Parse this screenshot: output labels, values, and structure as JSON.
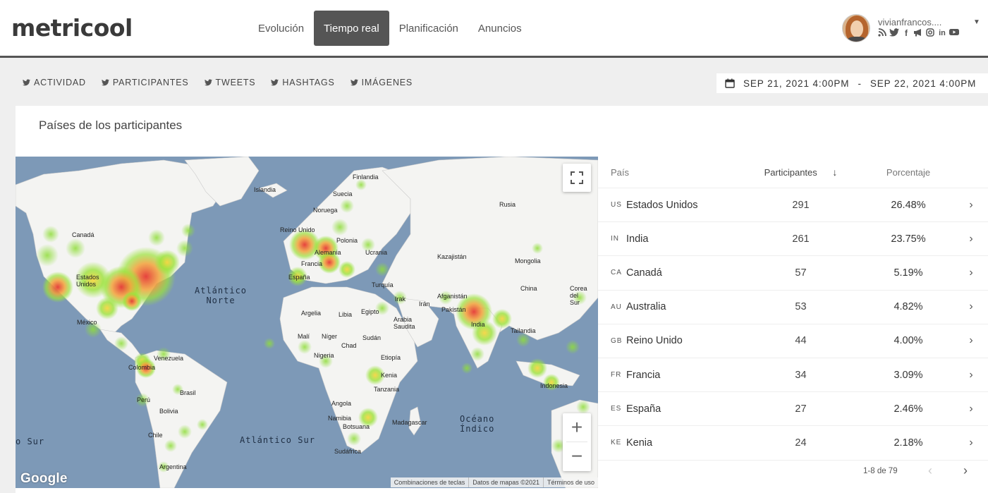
{
  "app": {
    "logo": "metricool",
    "nav": [
      "Evolución",
      "Tiempo real",
      "Planificación",
      "Anuncios"
    ],
    "active_nav": "Tiempo real",
    "user": {
      "name": "vivianfrancos....",
      "social_icons": [
        "rss-icon",
        "twitter-icon",
        "facebook-icon",
        "megaphone-icon",
        "instagram-icon",
        "linkedin-icon",
        "youtube-icon"
      ]
    }
  },
  "subtabs": [
    "ACTIVIDAD",
    "PARTICIPANTES",
    "TWEETS",
    "HASHTAGS",
    "IMÁGENES"
  ],
  "date_range": {
    "start": "SEP 21, 2021 4:00PM",
    "separator": "-",
    "end": "SEP 22, 2021 4:00PM"
  },
  "card": {
    "title": "Países de los participantes"
  },
  "map": {
    "labels": {
      "finlandia": "Finlandia",
      "islandia": "Islandia",
      "suecia": "Suecia",
      "noruega": "Noruega",
      "rusia": "Rusia",
      "reino_unido": "Reino Unido",
      "polonia": "Polonia",
      "alemania": "Alemania",
      "ucrania": "Ucrania",
      "kazajistan": "Kazajistán",
      "francia": "Francia",
      "mongolia": "Mongolia",
      "espana": "España",
      "turquia": "Turquía",
      "china": "China",
      "corea": "Corea del Sur",
      "canada": "Canadá",
      "estados_unidos": "Estados Unidos",
      "irak": "Irak",
      "iran": "Irán",
      "afganistan": "Afganistán",
      "argelia": "Argelia",
      "libia": "Libia",
      "egipto": "Egipto",
      "pakistan": "Pakistán",
      "mexico": "México",
      "arabia": "Arabia Saudita",
      "india": "India",
      "tailandia": "Tailandia",
      "mali": "Malí",
      "niger": "Níger",
      "chad": "Chad",
      "sudan": "Sudán",
      "venezuela": "Venezuela",
      "colombia": "Colombia",
      "nigeria": "Nigeria",
      "etiopia": "Etiopía",
      "kenia": "Kenia",
      "indonesia": "Indonesia",
      "tanzania": "Tanzania",
      "brasil": "Brasil",
      "peru": "Perú",
      "bolivia": "Bolivia",
      "angola": "Angola",
      "namibia": "Namibia",
      "madagascar": "Madagascar",
      "botsuana": "Botsuana",
      "chile": "Chile",
      "sudafrica": "Sudáfrica",
      "argentina": "Argentina"
    },
    "oceans": {
      "atlantico_norte": "Atlántico\nNorte",
      "atlantico_sur": "Atlántico Sur",
      "oceano_indico": "Océano\nÍndico",
      "sur_left": "o Sur"
    },
    "google": "Google",
    "attribution": [
      "Combinaciones de teclas",
      "Datos de mapas ©2021",
      "Términos de uso"
    ],
    "zoom_in": "+",
    "zoom_out": "−"
  },
  "table": {
    "headers": {
      "country": "País",
      "participants": "Participantes",
      "percentage": "Porcentaje"
    },
    "rows": [
      {
        "code": "US",
        "country": "Estados Unidos",
        "participants": "291",
        "percentage": "26.48%"
      },
      {
        "code": "IN",
        "country": "India",
        "participants": "261",
        "percentage": "23.75%"
      },
      {
        "code": "CA",
        "country": "Canadá",
        "participants": "57",
        "percentage": "5.19%"
      },
      {
        "code": "AU",
        "country": "Australia",
        "participants": "53",
        "percentage": "4.82%"
      },
      {
        "code": "GB",
        "country": "Reino Unido",
        "participants": "44",
        "percentage": "4.00%"
      },
      {
        "code": "FR",
        "country": "Francia",
        "participants": "34",
        "percentage": "3.09%"
      },
      {
        "code": "ES",
        "country": "España",
        "participants": "27",
        "percentage": "2.46%"
      },
      {
        "code": "KE",
        "country": "Kenia",
        "participants": "24",
        "percentage": "2.18%"
      }
    ],
    "pagination": "1-8 de 79"
  },
  "colors": {
    "accent": "#555555",
    "ocean": "#7d99b7",
    "land": "#f4f4f2",
    "heat_high": "#e53935",
    "heat_low": "#7ed321"
  }
}
